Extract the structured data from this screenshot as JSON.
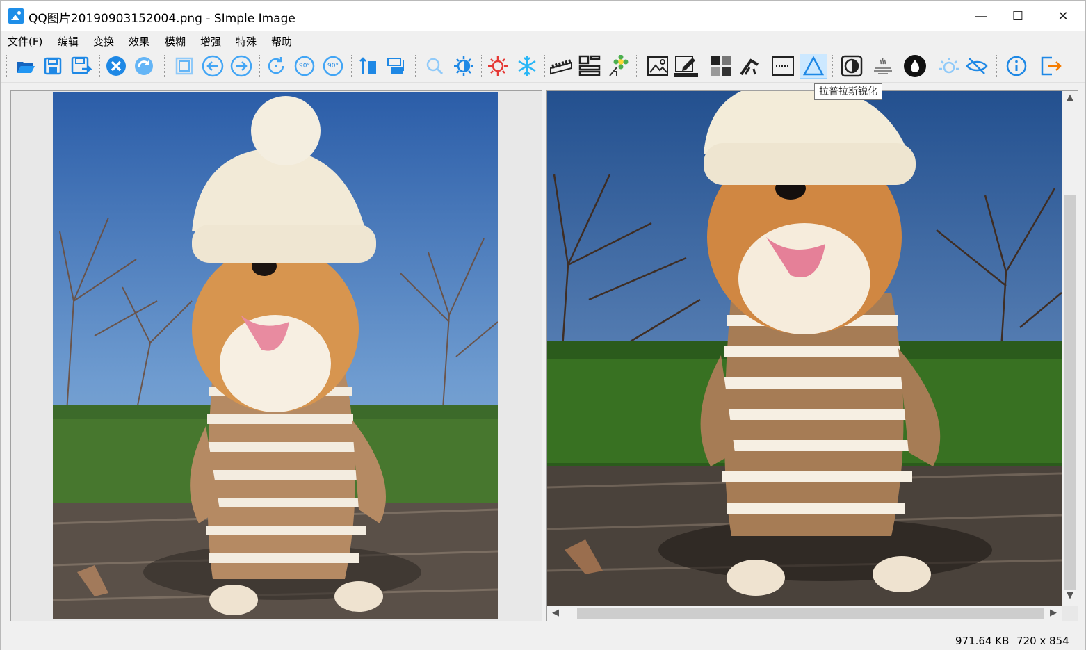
{
  "window": {
    "title": "QQ图片20190903152004.png - SImple Image",
    "minimize_label": "—",
    "maximize_label": "☐",
    "close_label": "✕"
  },
  "menu": {
    "items": [
      "文件(F)",
      "编辑",
      "变换",
      "效果",
      "模糊",
      "增强",
      "特殊",
      "帮助"
    ]
  },
  "toolbar": {
    "buttons": [
      "open-folder-icon",
      "save-icon",
      "save-as-icon",
      "close-image-icon",
      "redo-icon",
      "fit-icon",
      "rotate-left-icon",
      "rotate-right-icon",
      "rotate-cw-icon",
      "rotate-90-left-icon",
      "rotate-90-right-icon",
      "flip-vertical-icon",
      "flip-horizontal-icon",
      "zoom-icon",
      "brightness-icon",
      "sun-icon",
      "snowflake-icon",
      "film-icon",
      "layout-icon",
      "flower-icon",
      "image-icon",
      "edit-icon",
      "mosaic-icon",
      "sharpen-tool-icon",
      "dotted-frame-icon",
      "laplace-sharpen-icon",
      "contrast-icon",
      "emboss-icon",
      "drop-icon",
      "light-icon",
      "hide-icon",
      "info-icon",
      "exit-icon"
    ],
    "rotate_90_text": "90°",
    "tooltip": "拉普拉斯锐化"
  },
  "status": {
    "file_size": "971.64 KB",
    "dimensions": "720 x 854"
  },
  "colors": {
    "accent_blue": "#1e8ee8",
    "active_bg": "#cce8ff"
  }
}
